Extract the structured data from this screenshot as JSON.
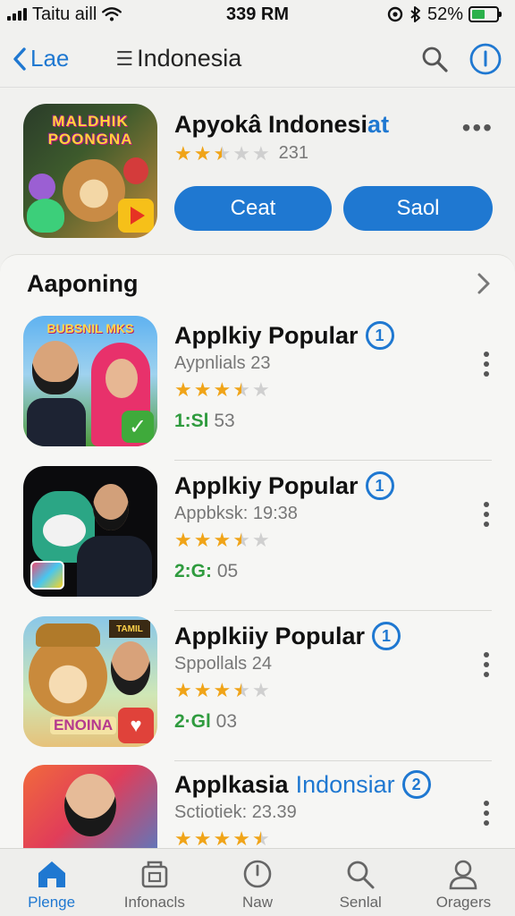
{
  "status_bar": {
    "carrier": "Taitu aill",
    "time": "339 RM",
    "battery": "52%",
    "battery_level": 0.52
  },
  "nav": {
    "back_label": "Lae",
    "title": "Indonesia",
    "menu_glyph": "☰"
  },
  "featured": {
    "title_main": "Apyokâ Indonesi",
    "title_accent": "at",
    "rating": 2.5,
    "rating_count": "231",
    "more": "•••",
    "button_primary": "Ceat",
    "button_secondary": "Saol",
    "icon_text": "MALDHIK POONGNA",
    "icon_name": "game-mascot-icon"
  },
  "section": {
    "title": "Aaponing"
  },
  "apps": [
    {
      "title": "Applkiy Popular",
      "badge": "1",
      "subtitle": "Aypnlials 23",
      "rating": 3.5,
      "meta_green": "1:Sl",
      "meta_rest": " 53",
      "thumb_text": "BUBSNIL MKS"
    },
    {
      "title": "Applkiy Popular",
      "badge": "1",
      "subtitle": "Appbksk: 19:38",
      "rating": 3.5,
      "meta_green": "2:G:",
      "meta_rest": " 05"
    },
    {
      "title": "Applkiiy Popular",
      "badge": "1",
      "subtitle": "Sppollals 24",
      "rating": 3.5,
      "meta_green": "2·Gl",
      "meta_rest": " 03",
      "thumb_sign": "TAMIL",
      "thumb_word": "ENOINA",
      "thumb_heart": "♥"
    },
    {
      "title": "Applkasia",
      "title_accent": "Indonsiar",
      "badge": "2",
      "subtitle": "Sctiotiek: 23.39",
      "rating": 4.5
    }
  ],
  "tabs": [
    {
      "label": "Plenge",
      "icon": "home-icon",
      "active": true
    },
    {
      "label": "Infonacls",
      "icon": "store-icon",
      "active": false
    },
    {
      "label": "Naw",
      "icon": "clock-icon",
      "active": false
    },
    {
      "label": "Senlal",
      "icon": "search-icon",
      "active": false
    },
    {
      "label": "Oragers",
      "icon": "person-icon",
      "active": false
    }
  ],
  "colors": {
    "accent": "#1f78d1",
    "star": "#f0a418",
    "green": "#2f9b3e",
    "background": "#f1f1ef"
  }
}
